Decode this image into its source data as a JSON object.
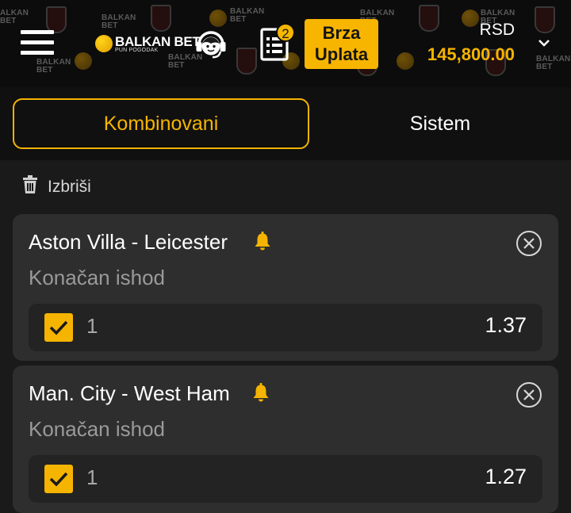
{
  "header": {
    "brand_name": "BALKAN BET",
    "brand_tagline": "PUN POGODAK",
    "slip_count": "2",
    "quick_pay_line1": "Brza",
    "quick_pay_line2": "Uplata",
    "currency": "RSD",
    "balance": "145,800.00",
    "icons": [
      "menu-icon",
      "headset-icon",
      "bet-slip-icon",
      "chevron-down-icon"
    ]
  },
  "tabs": [
    {
      "label": "Kombinovani",
      "active": true
    },
    {
      "label": "Sistem",
      "active": false
    }
  ],
  "delete_label": "Izbriši",
  "bets": [
    {
      "match": "Aston Villa - Leicester",
      "market": "Konačan ishod",
      "pick": "1",
      "odds": "1.37",
      "checked": true
    },
    {
      "match": "Man. City - West Ham",
      "market": "Konačan ishod",
      "pick": "1",
      "odds": "1.27",
      "checked": true
    }
  ],
  "colors": {
    "accent": "#f5b400",
    "background": "#1a1a1a",
    "header": "#0c0c0c",
    "card": "#2e2e2e",
    "selection_row": "#232323"
  }
}
